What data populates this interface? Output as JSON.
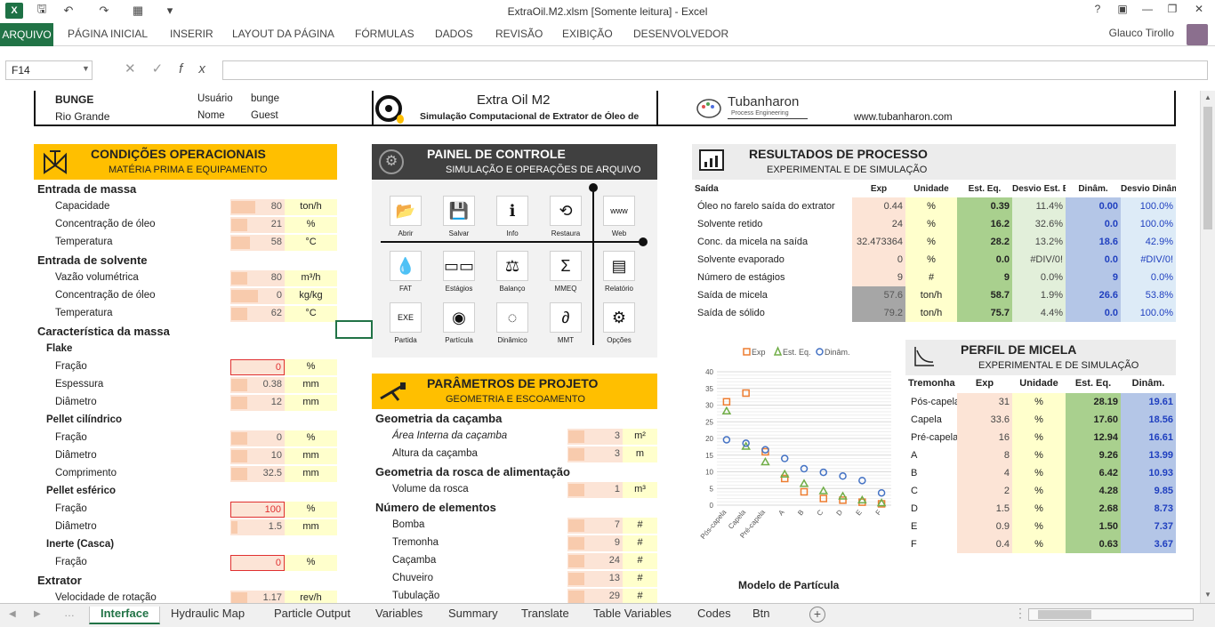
{
  "window": {
    "title": "ExtraOil.M2.xlsm  [Somente leitura] - Excel",
    "help": "?",
    "user": "Glauco Tirollo"
  },
  "ribbon": {
    "file": "ARQUIVO",
    "tabs": [
      "PÁGINA INICIAL",
      "INSERIR",
      "LAYOUT DA PÁGINA",
      "FÓRMULAS",
      "DADOS",
      "REVISÃO",
      "EXIBIÇÃO",
      "DESENVOLVEDOR"
    ]
  },
  "formula": {
    "namebox": "F14",
    "value": ""
  },
  "header": {
    "company": "BUNGE",
    "city": "Rio Grande",
    "user_label": "Usuário",
    "user_value": "bunge",
    "name_label": "Nome",
    "name_value": "Guest",
    "app_title": "Extra Oil M2",
    "app_subtitle": "Simulação Computacional de Extrator de Óleo de",
    "brand": "Tubanharon",
    "brand_sub": "Process Engineering",
    "website": "www.tubanharon.com"
  },
  "cond": {
    "title": "CONDIÇÕES OPERACIONAIS",
    "subtitle": "MATÉRIA PRIMA E EQUIPAMENTO",
    "rows": [
      {
        "t": "h",
        "label": "Entrada de massa"
      },
      {
        "t": "r",
        "label": "Capacidade",
        "value": "80",
        "unit": "ton/h",
        "pct": 0.45
      },
      {
        "t": "r",
        "label": "Concentração de óleo",
        "value": "21",
        "unit": "%",
        "pct": 0.3
      },
      {
        "t": "r",
        "label": "Temperatura",
        "value": "58",
        "unit": "°C",
        "pct": 0.35
      },
      {
        "t": "h",
        "label": "Entrada de solvente"
      },
      {
        "t": "r",
        "label": "Vazão volumétrica",
        "value": "80",
        "unit": "m³/h",
        "pct": 0.3
      },
      {
        "t": "r",
        "label": "Concentração de óleo",
        "value": "0",
        "unit": "kg/kg",
        "pct": 0.5
      },
      {
        "t": "r",
        "label": "Temperatura",
        "value": "62",
        "unit": "°C",
        "pct": 0.3
      },
      {
        "t": "h",
        "label": "Característica da massa"
      },
      {
        "t": "s",
        "label": "Flake"
      },
      {
        "t": "r",
        "label": "Fração",
        "value": "0",
        "unit": "%",
        "red": true
      },
      {
        "t": "r",
        "label": "Espessura",
        "value": "0.38",
        "unit": "mm",
        "pct": 0.3
      },
      {
        "t": "r",
        "label": "Diâmetro",
        "value": "12",
        "unit": "mm",
        "pct": 0.3
      },
      {
        "t": "s",
        "label": "Pellet cilíndrico"
      },
      {
        "t": "r",
        "label": "Fração",
        "value": "0",
        "unit": "%",
        "pct": 0.3
      },
      {
        "t": "r",
        "label": "Diâmetro",
        "value": "10",
        "unit": "mm",
        "pct": 0.3
      },
      {
        "t": "r",
        "label": "Comprimento",
        "value": "32.5",
        "unit": "mm",
        "pct": 0.3
      },
      {
        "t": "s",
        "label": "Pellet esférico"
      },
      {
        "t": "r",
        "label": "Fração",
        "value": "100",
        "unit": "%",
        "red": true
      },
      {
        "t": "r",
        "label": "Diâmetro",
        "value": "1.5",
        "unit": "mm",
        "pct": 0.12
      },
      {
        "t": "s",
        "label": "Inerte (Casca)"
      },
      {
        "t": "r",
        "label": "Fração",
        "value": "0",
        "unit": "%",
        "red": true
      },
      {
        "t": "h",
        "label": "Extrator"
      },
      {
        "t": "r",
        "label": "Velocidade de rotação",
        "value": "1.17",
        "unit": "rev/h",
        "pct": 0.3
      }
    ]
  },
  "panel": {
    "title": "PAINEL DE CONTROLE",
    "subtitle": "SIMULAÇÃO E OPERAÇÕES DE ARQUIVO",
    "buttons": [
      {
        "label": "Abrir",
        "icon": "folder-icon",
        "glyph": "📂"
      },
      {
        "label": "Salvar",
        "icon": "save-icon",
        "glyph": "💾"
      },
      {
        "label": "Info",
        "icon": "info-icon",
        "glyph": "ℹ"
      },
      {
        "label": "Restaura",
        "icon": "restore-icon",
        "glyph": "⟲"
      },
      {
        "label": "Web",
        "icon": "web-icon",
        "glyph": "www"
      },
      {
        "label": "FAT",
        "icon": "drop-icon",
        "glyph": "💧"
      },
      {
        "label": "Estágios",
        "icon": "stages-icon",
        "glyph": "▭▭"
      },
      {
        "label": "Balanço",
        "icon": "balance-icon",
        "glyph": "⚖"
      },
      {
        "label": "MMEQ",
        "icon": "sigma-icon",
        "glyph": "Σ"
      },
      {
        "label": "Relatório",
        "icon": "report-icon",
        "glyph": "▤"
      },
      {
        "label": "Partida",
        "icon": "exe-icon",
        "glyph": "EXE"
      },
      {
        "label": "Partícula",
        "icon": "particle-icon",
        "glyph": "◉"
      },
      {
        "label": "Dinâmico",
        "icon": "dynamic-icon",
        "glyph": "◌"
      },
      {
        "label": "MMT",
        "icon": "partial-icon",
        "glyph": "∂"
      },
      {
        "label": "Opções",
        "icon": "gear-icon",
        "glyph": "⚙"
      }
    ]
  },
  "params": {
    "title": "PARÂMETROS DE PROJETO",
    "subtitle": "GEOMETRIA E ESCOAMENTO",
    "rows": [
      {
        "t": "h",
        "label": "Geometria da caçamba"
      },
      {
        "t": "r",
        "label": "Área Interna da caçamba",
        "value": "3",
        "unit": "m²",
        "italic": true
      },
      {
        "t": "r",
        "label": "Altura da caçamba",
        "value": "3",
        "unit": "m"
      },
      {
        "t": "h",
        "label": "Geometria da rosca de alimentação"
      },
      {
        "t": "r",
        "label": "Volume da rosca",
        "value": "1",
        "unit": "m³"
      },
      {
        "t": "h",
        "label": "Número de elementos"
      },
      {
        "t": "r",
        "label": "Bomba",
        "value": "7",
        "unit": "#"
      },
      {
        "t": "r",
        "label": "Tremonha",
        "value": "9",
        "unit": "#"
      },
      {
        "t": "r",
        "label": "Caçamba",
        "value": "24",
        "unit": "#"
      },
      {
        "t": "r",
        "label": "Chuveiro",
        "value": "13",
        "unit": "#"
      },
      {
        "t": "r",
        "label": "Tubulação",
        "value": "29",
        "unit": "#"
      }
    ]
  },
  "results": {
    "title": "RESULTADOS DE PROCESSO",
    "subtitle": "EXPERIMENTAL E DE SIMULAÇÃO",
    "headers": [
      "Saída",
      "Exp",
      "Unidade",
      "Est. Eq.",
      "Desvio Est. E",
      "Dinâm.",
      "Desvio Dinâm."
    ],
    "rows": [
      [
        "Óleo no farelo saída do extrator",
        "0.44",
        "%",
        "0.39",
        "11.4%",
        "0.00",
        "100.0%"
      ],
      [
        "Solvente retido",
        "24",
        "%",
        "16.2",
        "32.6%",
        "0.0",
        "100.0%"
      ],
      [
        "Conc. da micela na saída",
        "32.473364",
        "%",
        "28.2",
        "13.2%",
        "18.6",
        "42.9%"
      ],
      [
        "Solvente evaporado",
        "0",
        "%",
        "0.0",
        "#DIV/0!",
        "0.0",
        "#DIV/0!"
      ],
      [
        "Número de estágios",
        "9",
        "#",
        "9",
        "0.0%",
        "9",
        "0.0%"
      ],
      [
        "Saída de micela",
        "57.6",
        "ton/h",
        "58.7",
        "1.9%",
        "26.6",
        "53.8%"
      ],
      [
        "Saída de sólido",
        "79.2",
        "ton/h",
        "75.7",
        "4.4%",
        "0.0",
        "100.0%"
      ]
    ]
  },
  "micela": {
    "title": "PERFIL DE MICELA",
    "subtitle": "EXPERIMENTAL E DE SIMULAÇÃO",
    "headers": [
      "Tremonha",
      "Exp",
      "Unidade",
      "Est. Eq.",
      "Dinâm."
    ],
    "rows": [
      [
        "Pós-capela",
        "31",
        "%",
        "28.19",
        "19.61"
      ],
      [
        "Capela",
        "33.6",
        "%",
        "17.60",
        "18.56"
      ],
      [
        "Pré-capela",
        "16",
        "%",
        "12.94",
        "16.61"
      ],
      [
        "A",
        "8",
        "%",
        "9.26",
        "13.99"
      ],
      [
        "B",
        "4",
        "%",
        "6.42",
        "10.93"
      ],
      [
        "C",
        "2",
        "%",
        "4.28",
        "9.85"
      ],
      [
        "D",
        "1.5",
        "%",
        "2.68",
        "8.73"
      ],
      [
        "E",
        "0.9",
        "%",
        "1.50",
        "7.37"
      ],
      [
        "F",
        "0.4",
        "%",
        "0.63",
        "3.67"
      ]
    ]
  },
  "chart_data": {
    "type": "scatter",
    "categories": [
      "Pós-capela",
      "Capela",
      "Pré-capela",
      "A",
      "B",
      "C",
      "D",
      "E",
      "F"
    ],
    "ylim": [
      0,
      40
    ],
    "yticks": [
      "0",
      "5",
      "10",
      "15",
      "20",
      "25",
      "30",
      "35",
      "40"
    ],
    "series": [
      {
        "name": "Exp",
        "color": "#ed7d31",
        "marker": "square",
        "values": [
          31,
          33.6,
          16,
          8,
          4,
          2,
          1.5,
          0.9,
          0.4
        ]
      },
      {
        "name": "Est. Eq.",
        "color": "#70ad47",
        "marker": "triangle",
        "values": [
          28.19,
          17.6,
          12.94,
          9.26,
          6.42,
          4.28,
          2.68,
          1.5,
          0.63
        ]
      },
      {
        "name": "Dinâm.",
        "color": "#4472c4",
        "marker": "circle",
        "values": [
          19.61,
          18.56,
          16.61,
          13.99,
          10.93,
          9.85,
          8.73,
          7.37,
          3.67
        ]
      }
    ]
  },
  "particle_title": "Modelo de Partícula",
  "sheets": [
    "Interface",
    "Hydraulic Map",
    "Particle Output",
    "Variables",
    "Summary",
    "Translate",
    "Table Variables",
    "Codes",
    "Btn"
  ]
}
